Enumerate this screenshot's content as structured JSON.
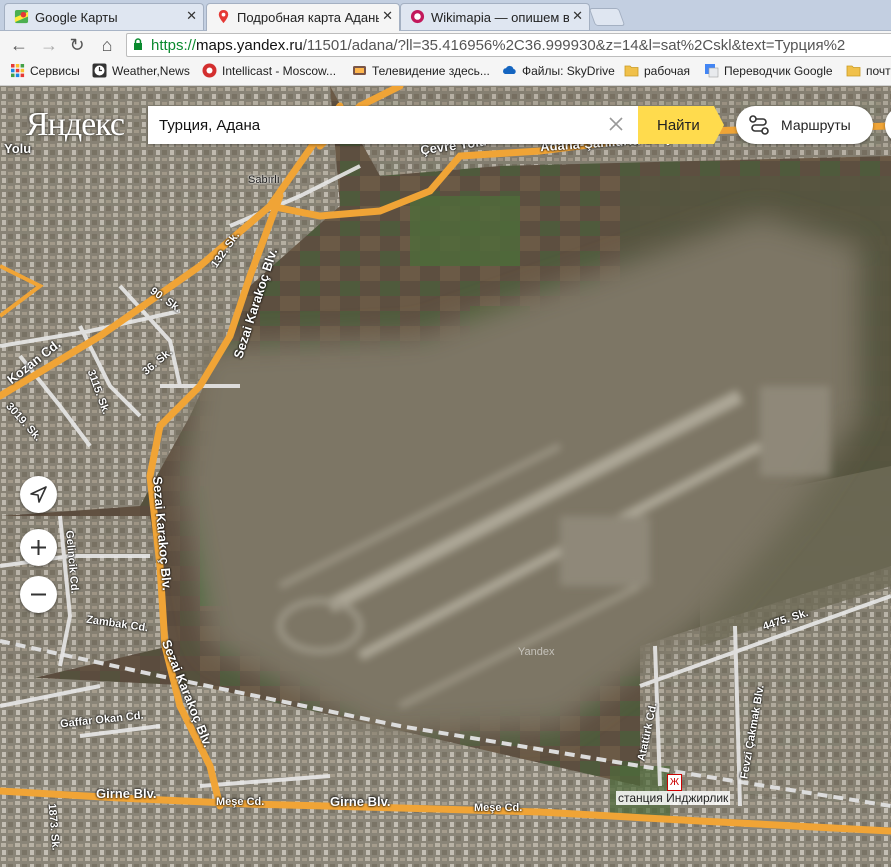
{
  "browser": {
    "tabs": [
      {
        "title": "Google Карты",
        "icon": "google-maps-icon",
        "active": false
      },
      {
        "title": "Подробная карта Аданы",
        "icon": "yandex-maps-pin-icon",
        "active": true
      },
      {
        "title": "Wikimapia — опишем вес",
        "icon": "wikimapia-icon",
        "active": false
      }
    ],
    "address": {
      "protocol": "https://",
      "host": "maps.yandex.ru",
      "path": "/11501/adana/?ll=35.416956%2C36.999930&z=14&l=sat%2Cskl&text=Турция%2"
    },
    "bookmarks": [
      {
        "label": "Сервисы",
        "icon": "apps-grid-icon"
      },
      {
        "label": "Weather,News",
        "icon": "clock-icon"
      },
      {
        "label": "Intellicast - Moscow...",
        "icon": "intellicast-icon"
      },
      {
        "label": "Телевидение здесь...",
        "icon": "tv-icon"
      },
      {
        "label": "Файлы: SkyDrive",
        "icon": "cloud-icon"
      },
      {
        "label": "рабочая",
        "icon": "folder-icon"
      },
      {
        "label": "Переводчик Google",
        "icon": "translate-icon"
      },
      {
        "label": "почт",
        "icon": "folder-icon"
      }
    ]
  },
  "yandex": {
    "logo": "Яндекс",
    "search_value": "Турция, Адана",
    "find_label": "Найти",
    "routes_label": "Маршруты",
    "accent": "#ffdb4d"
  },
  "map": {
    "watermark": "Yandex",
    "station": "станция Инджирлик",
    "metro_glyph": "Ж",
    "labels": {
      "yolu_left": "Yolu",
      "cevre_yolu": "Çevre Yolu",
      "adana_sanliurfa": "Adana-Şanlıurfa Otoyolu",
      "sabirli": "Sabırlı",
      "sk132": "132. Sk.",
      "karakoc_top": "Sezai Karakoç Blv.",
      "sk90": "90. Sk.",
      "kozan": "Kozan Cd.",
      "sk3115": "3115. Sk.",
      "sk36": "36. Sk.",
      "sk3019": "3019. Sk.",
      "karakoc_mid": "Sezai Karakoç Blv.",
      "gelincik": "Gelincik Cd.",
      "zambak": "Zambak Cd.",
      "karakoc_bottom": "Sezai Karakoç Blv.",
      "gaffar": "Gaffar Okan Cd.",
      "girne_left": "Girne Blv.",
      "mese_left": "Meşe Cd.",
      "girne_mid": "Girne Blv.",
      "mese_right": "Meşe Cd.",
      "sk1873": "1873. Sk.",
      "sk4475": "4475. Sk.",
      "ataturk": "Atatürk Cd.",
      "fevzi": "Fevzi Çakmak Blv."
    }
  }
}
